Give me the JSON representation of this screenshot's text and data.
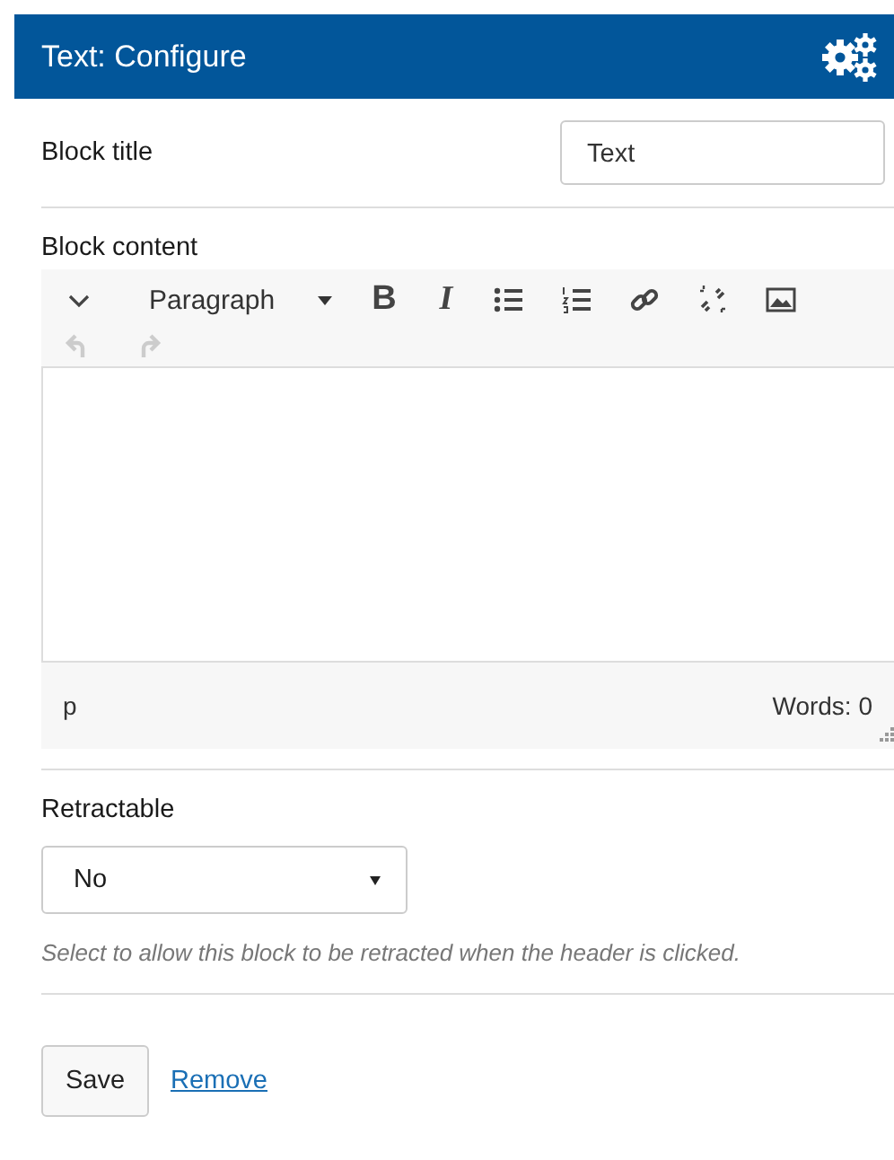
{
  "header": {
    "title": "Text: Configure"
  },
  "block_title": {
    "label": "Block title",
    "value": "Text"
  },
  "block_content": {
    "label": "Block content",
    "toolbar_rows": [
      [
        {
          "kind": "collapse",
          "disabled": false
        },
        {
          "kind": "format",
          "label": "Paragraph",
          "disabled": false
        },
        {
          "kind": "bold",
          "label": "B",
          "disabled": false
        },
        {
          "kind": "italic",
          "label": "I",
          "disabled": false
        },
        {
          "kind": "bullets",
          "disabled": false
        },
        {
          "kind": "numbers",
          "disabled": false
        },
        {
          "kind": "link",
          "disabled": false
        },
        {
          "kind": "unlink",
          "disabled": false
        },
        {
          "kind": "image",
          "disabled": false
        }
      ],
      [
        {
          "kind": "undo",
          "disabled": true
        },
        {
          "kind": "redo",
          "disabled": true
        }
      ]
    ],
    "path": "p",
    "word_count": "Words: 0"
  },
  "retractable": {
    "label": "Retractable",
    "value": "No",
    "help": "Select to allow this block to be retracted when the header is clicked."
  },
  "buttons": {
    "save": "Save",
    "remove": "Remove"
  }
}
